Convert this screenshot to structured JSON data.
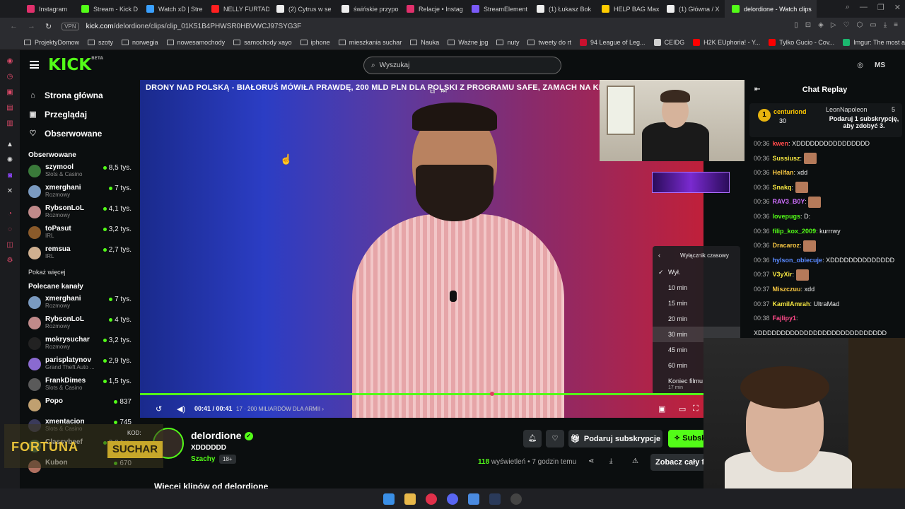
{
  "browser": {
    "tabs": [
      {
        "label": "Instagram",
        "color": "#e1306c"
      },
      {
        "label": "Stream - Kick D",
        "color": "#53fc18"
      },
      {
        "label": "Watch xD | Stre",
        "color": "#3aa0ff"
      },
      {
        "label": "NELLY FURTADO",
        "color": "#ff2020"
      },
      {
        "label": "(2) Cytrus w se",
        "color": "#eeeeee"
      },
      {
        "label": "świńskie przypo",
        "color": "#eeeeee"
      },
      {
        "label": "Relacje • Instag",
        "color": "#e1306c"
      },
      {
        "label": "StreamElement",
        "color": "#7a5af8"
      },
      {
        "label": "(1) Łukasz Bok",
        "color": "#eeeeee"
      },
      {
        "label": "HELP BAG Max",
        "color": "#ffcc00"
      },
      {
        "label": "(1) Główna / X",
        "color": "#eeeeee"
      },
      {
        "label": "delordione - Watch clips",
        "color": "#53fc18"
      }
    ],
    "vpn": "VPN",
    "url_host": "kick.com",
    "url_path": "/delordione/clips/clip_01K51B4PHWSR0HBVWCJ97SYG3F",
    "bookmarks": [
      {
        "label": "ProjektyDomow",
        "type": "folder"
      },
      {
        "label": "szoty",
        "type": "folder"
      },
      {
        "label": "norwegia",
        "type": "folder"
      },
      {
        "label": "nowesamochody",
        "type": "folder"
      },
      {
        "label": "samochody xayo",
        "type": "folder"
      },
      {
        "label": "iphone",
        "type": "folder"
      },
      {
        "label": "mieszkania suchar",
        "type": "folder"
      },
      {
        "label": "Nauka",
        "type": "folder"
      },
      {
        "label": "Ważne jpg",
        "type": "folder"
      },
      {
        "label": "nuty",
        "type": "folder"
      },
      {
        "label": "tweety do rt",
        "type": "folder"
      },
      {
        "label": "94 League of Leg...",
        "type": "site",
        "color": "#c8102e"
      },
      {
        "label": "CEIDG",
        "type": "site",
        "color": "#d0d0d0"
      },
      {
        "label": "H2K EUphoria! - Y...",
        "type": "site",
        "color": "#ff0000"
      },
      {
        "label": "Tylko Gucio - Cov...",
        "type": "site",
        "color": "#ff0000"
      },
      {
        "label": "Imgur: The most a...",
        "type": "site",
        "color": "#1bb76e"
      }
    ]
  },
  "kick": {
    "logo": "KICK",
    "logo_badge": "BETA",
    "search_placeholder": "Wyszukaj",
    "user_initials": "MS",
    "accent": "#53fc18",
    "nav": [
      {
        "label": "Strona główna",
        "icon": "home-icon",
        "glyph": "⌂"
      },
      {
        "label": "Przeglądaj",
        "icon": "browse-icon",
        "glyph": "▣"
      },
      {
        "label": "Obserwowane",
        "icon": "heart-icon",
        "glyph": "♡"
      }
    ],
    "followed_title": "Obserwowane",
    "followed": [
      {
        "name": "szymool",
        "cat": "Slots & Casino",
        "viewers": "8,5 tys.",
        "color": "#3a7a3a"
      },
      {
        "name": "xmerghani",
        "cat": "Rozmowy",
        "viewers": "7 tys.",
        "color": "#7a9ac0"
      },
      {
        "name": "RybsonLoL",
        "cat": "Rozmowy",
        "viewers": "4,1 tys.",
        "color": "#c08a8a"
      },
      {
        "name": "toPasut",
        "cat": "IRL",
        "viewers": "3,2 tys.",
        "color": "#8a5a2a"
      },
      {
        "name": "remsua",
        "cat": "IRL",
        "viewers": "2,7 tys.",
        "color": "#d0b090"
      }
    ],
    "show_more": "Pokaż więcej",
    "recommended_title": "Polecane kanały",
    "recommended": [
      {
        "name": "xmerghani",
        "cat": "Rozmowy",
        "viewers": "7 tys.",
        "color": "#7a9ac0"
      },
      {
        "name": "RybsonLoL",
        "cat": "Rozmowy",
        "viewers": "4 tys.",
        "color": "#c08a8a"
      },
      {
        "name": "mokrysuchar",
        "cat": "Rozmowy",
        "viewers": "3,2 tys.",
        "color": "#222222",
        "initials": "MS"
      },
      {
        "name": "parisplatynov",
        "cat": "Grand Theft Auto ...",
        "viewers": "2,9 tys.",
        "color": "#8a6ad0"
      },
      {
        "name": "FrankDimes",
        "cat": "Slots & Casino",
        "viewers": "1,5 tys.",
        "color": "#5a5a5a"
      },
      {
        "name": "Popo",
        "cat": "",
        "viewers": "837",
        "color": "#c0a070"
      },
      {
        "name": "xmentacion",
        "cat": "Slots & Casino",
        "viewers": "745",
        "color": "#3a3a5a"
      },
      {
        "name": "Classybeef",
        "cat": "",
        "viewers": "3,2 tys.",
        "color": "#4a7a4a"
      },
      {
        "name": "Kubon",
        "cat": "",
        "viewers": "670",
        "color": "#b07060"
      }
    ]
  },
  "video": {
    "title": "DRONY NAD POLSKĄ - BIAŁORUŚ MÓWIŁA PRAWDĘ, 200 MLD PLN DLA POLSKI Z PROGRAMU SAFE, ZAMACH NA KIRK",
    "time": "00:41 / 00:41",
    "clip_subtitle": "17 · 200 MILIARDÓW DLA ARMII ›",
    "progress": 1.0,
    "sleep_menu": {
      "title": "Wyłącznik czasowy",
      "items": [
        "Wył.",
        "10 min",
        "15 min",
        "20 min",
        "30 min",
        "45 min",
        "60 min",
        "Koniec filmu"
      ],
      "checked": "Wył.",
      "hovered": "30 min",
      "end_sub": "17 min"
    }
  },
  "clip": {
    "channel": "delordione",
    "title": "XDDDDDD",
    "category": "Szachy",
    "age": "18+",
    "subscribe_gift": "Podaruj subskrypcje",
    "subscribe": "Subskrybuj",
    "views_num": "118",
    "views_label": "wyświetleń",
    "ago": "• 7 godzin temu",
    "watch_all": "Zobacz cały film",
    "more_clips": "Więcej klipów od delordione"
  },
  "chat": {
    "title": "Chat Replay",
    "pinned": {
      "rank": "1",
      "user": "centuriond",
      "amount": "30",
      "gifter": "LeonNapoleon",
      "gifter_count": "5",
      "text": "Podaruj 1 subskrypcję, aby zdobyć 3."
    },
    "messages": [
      {
        "t": "00:36",
        "u": "kwen",
        "c": "#ff4a4a",
        "m": "XDDDDDDDDDDDDDDDD"
      },
      {
        "t": "00:36",
        "u": "Sussiusz",
        "c": "#f5e642",
        "m": "",
        "emote": true
      },
      {
        "t": "00:36",
        "u": "Hellfan",
        "c": "#f5c542",
        "m": "xdd"
      },
      {
        "t": "00:36",
        "u": "Snakq",
        "c": "#f5e642",
        "m": "",
        "emote": true
      },
      {
        "t": "00:36",
        "u": "RAV3_B0Y",
        "c": "#d070ff",
        "m": "",
        "emote": true
      },
      {
        "t": "00:36",
        "u": "lovepugs",
        "c": "#53fc18",
        "m": "D:"
      },
      {
        "t": "00:36",
        "u": "filip_kox_2009",
        "c": "#53fc18",
        "m": "kurrrwy"
      },
      {
        "t": "00:36",
        "u": "Dracaroz",
        "c": "#f5c542",
        "m": "",
        "emote": true
      },
      {
        "t": "00:36",
        "u": "hylson_obiecuje",
        "c": "#5a8aff",
        "m": "XDDDDDDDDDDDDDD"
      },
      {
        "t": "00:37",
        "u": "V3yXir",
        "c": "#f5e642",
        "m": "",
        "emote": true
      },
      {
        "t": "00:37",
        "u": "Miszczuu",
        "c": "#f5c542",
        "m": "xdd"
      },
      {
        "t": "00:37",
        "u": "KamilAmrah",
        "c": "#f5e642",
        "m": "UltraMad"
      },
      {
        "t": "00:38",
        "u": "Fajlipy1",
        "c": "#ff4a8a",
        "m": ""
      },
      {
        "t": "",
        "u": "",
        "c": "#fff",
        "m": "XDDDDDDDDDDDDDDDDDDDDDDDDDDDD"
      }
    ]
  },
  "overlay": {
    "sponsor": "FORTUNA",
    "code_label": "KOD:",
    "code": "SUCHAR"
  }
}
